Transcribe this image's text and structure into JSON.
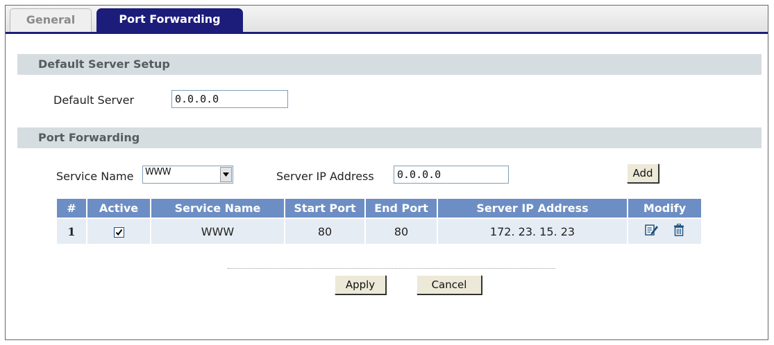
{
  "tabs": [
    {
      "label": "General",
      "active": false
    },
    {
      "label": "Port Forwarding",
      "active": true
    }
  ],
  "default_server_setup": {
    "title": "Default Server Setup",
    "default_server_label": "Default Server",
    "default_server_value": "0.0.0.0"
  },
  "port_forwarding": {
    "title": "Port Forwarding",
    "service_name_label": "Service Name",
    "service_name_value": "WWW",
    "server_ip_label": "Server IP Address",
    "server_ip_value": "0.0.0.0",
    "add_label": "Add",
    "columns": [
      "#",
      "Active",
      "Service Name",
      "Start Port",
      "End Port",
      "Server IP Address",
      "Modify"
    ],
    "rows": [
      {
        "index": "1",
        "active": true,
        "service_name": "WWW",
        "start_port": "80",
        "end_port": "80",
        "server_ip": "172. 23. 15. 23"
      }
    ]
  },
  "buttons": {
    "apply_label": "Apply",
    "cancel_label": "Cancel"
  },
  "colors": {
    "tab_active": "#1c1c7a",
    "section_bar": "#d6dde0",
    "table_header": "#6d8ec4",
    "table_row": "#e6ecf3",
    "icon_blue": "#1c5180"
  },
  "icons": {
    "dropdown": "chevron-down-icon",
    "checkbox": "checkmark-icon",
    "edit": "edit-icon",
    "delete": "trash-icon"
  }
}
